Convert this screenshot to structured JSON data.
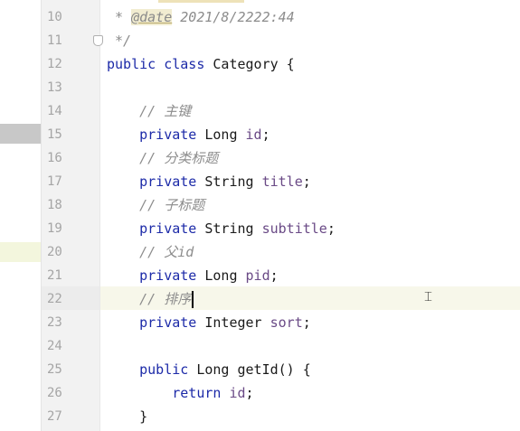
{
  "editor": {
    "language": "java",
    "colors": {
      "keyword": "#1c2aa8",
      "field": "#6a4a86",
      "comment": "#8c8c8c",
      "line_number": "#a5a5a5",
      "current_line": "#f7f7ea"
    },
    "current_line": 22,
    "lines": [
      {
        "n": "10",
        "tokens": [
          {
            "t": "doc",
            "v": " * "
          },
          {
            "t": "tag",
            "v": "@date"
          },
          {
            "t": "doc",
            "v": " 2021/8/2222:44"
          }
        ]
      },
      {
        "n": "11",
        "tokens": [
          {
            "t": "doc",
            "v": " */"
          }
        ]
      },
      {
        "n": "12",
        "tokens": [
          {
            "t": "kw",
            "v": "public class "
          },
          {
            "t": "type",
            "v": "Category {"
          }
        ]
      },
      {
        "n": "13",
        "tokens": []
      },
      {
        "n": "14",
        "tokens": [
          {
            "t": "cmt",
            "v": "    // 主键"
          }
        ]
      },
      {
        "n": "15",
        "tokens": [
          {
            "t": "kw",
            "v": "    private "
          },
          {
            "t": "type",
            "v": "Long "
          },
          {
            "t": "field",
            "v": "id"
          },
          {
            "t": "plain",
            "v": ";"
          }
        ]
      },
      {
        "n": "16",
        "tokens": [
          {
            "t": "cmt",
            "v": "    // 分类标题"
          }
        ]
      },
      {
        "n": "17",
        "tokens": [
          {
            "t": "kw",
            "v": "    private "
          },
          {
            "t": "type",
            "v": "String "
          },
          {
            "t": "field",
            "v": "title"
          },
          {
            "t": "plain",
            "v": ";"
          }
        ]
      },
      {
        "n": "18",
        "tokens": [
          {
            "t": "cmt",
            "v": "    // 子标题"
          }
        ]
      },
      {
        "n": "19",
        "tokens": [
          {
            "t": "kw",
            "v": "    private "
          },
          {
            "t": "type",
            "v": "String "
          },
          {
            "t": "field",
            "v": "subtitle"
          },
          {
            "t": "plain",
            "v": ";"
          }
        ]
      },
      {
        "n": "20",
        "tokens": [
          {
            "t": "cmt",
            "v": "    // 父id"
          }
        ]
      },
      {
        "n": "21",
        "tokens": [
          {
            "t": "kw",
            "v": "    private "
          },
          {
            "t": "type",
            "v": "Long "
          },
          {
            "t": "field",
            "v": "pid"
          },
          {
            "t": "plain",
            "v": ";"
          }
        ]
      },
      {
        "n": "22",
        "tokens": [
          {
            "t": "cmt",
            "v": "    // 排序"
          },
          {
            "t": "caret",
            "v": ""
          }
        ]
      },
      {
        "n": "23",
        "tokens": [
          {
            "t": "kw",
            "v": "    private "
          },
          {
            "t": "type",
            "v": "Integer "
          },
          {
            "t": "field",
            "v": "sort"
          },
          {
            "t": "plain",
            "v": ";"
          }
        ]
      },
      {
        "n": "24",
        "tokens": []
      },
      {
        "n": "25",
        "tokens": [
          {
            "t": "kw",
            "v": "    public "
          },
          {
            "t": "type",
            "v": "Long "
          },
          {
            "t": "fn",
            "v": "getId"
          },
          {
            "t": "plain",
            "v": "() {"
          }
        ]
      },
      {
        "n": "26",
        "tokens": [
          {
            "t": "kw",
            "v": "        return "
          },
          {
            "t": "field",
            "v": "id"
          },
          {
            "t": "plain",
            "v": ";"
          }
        ]
      },
      {
        "n": "27",
        "tokens": [
          {
            "t": "plain",
            "v": "    }"
          }
        ]
      }
    ]
  }
}
